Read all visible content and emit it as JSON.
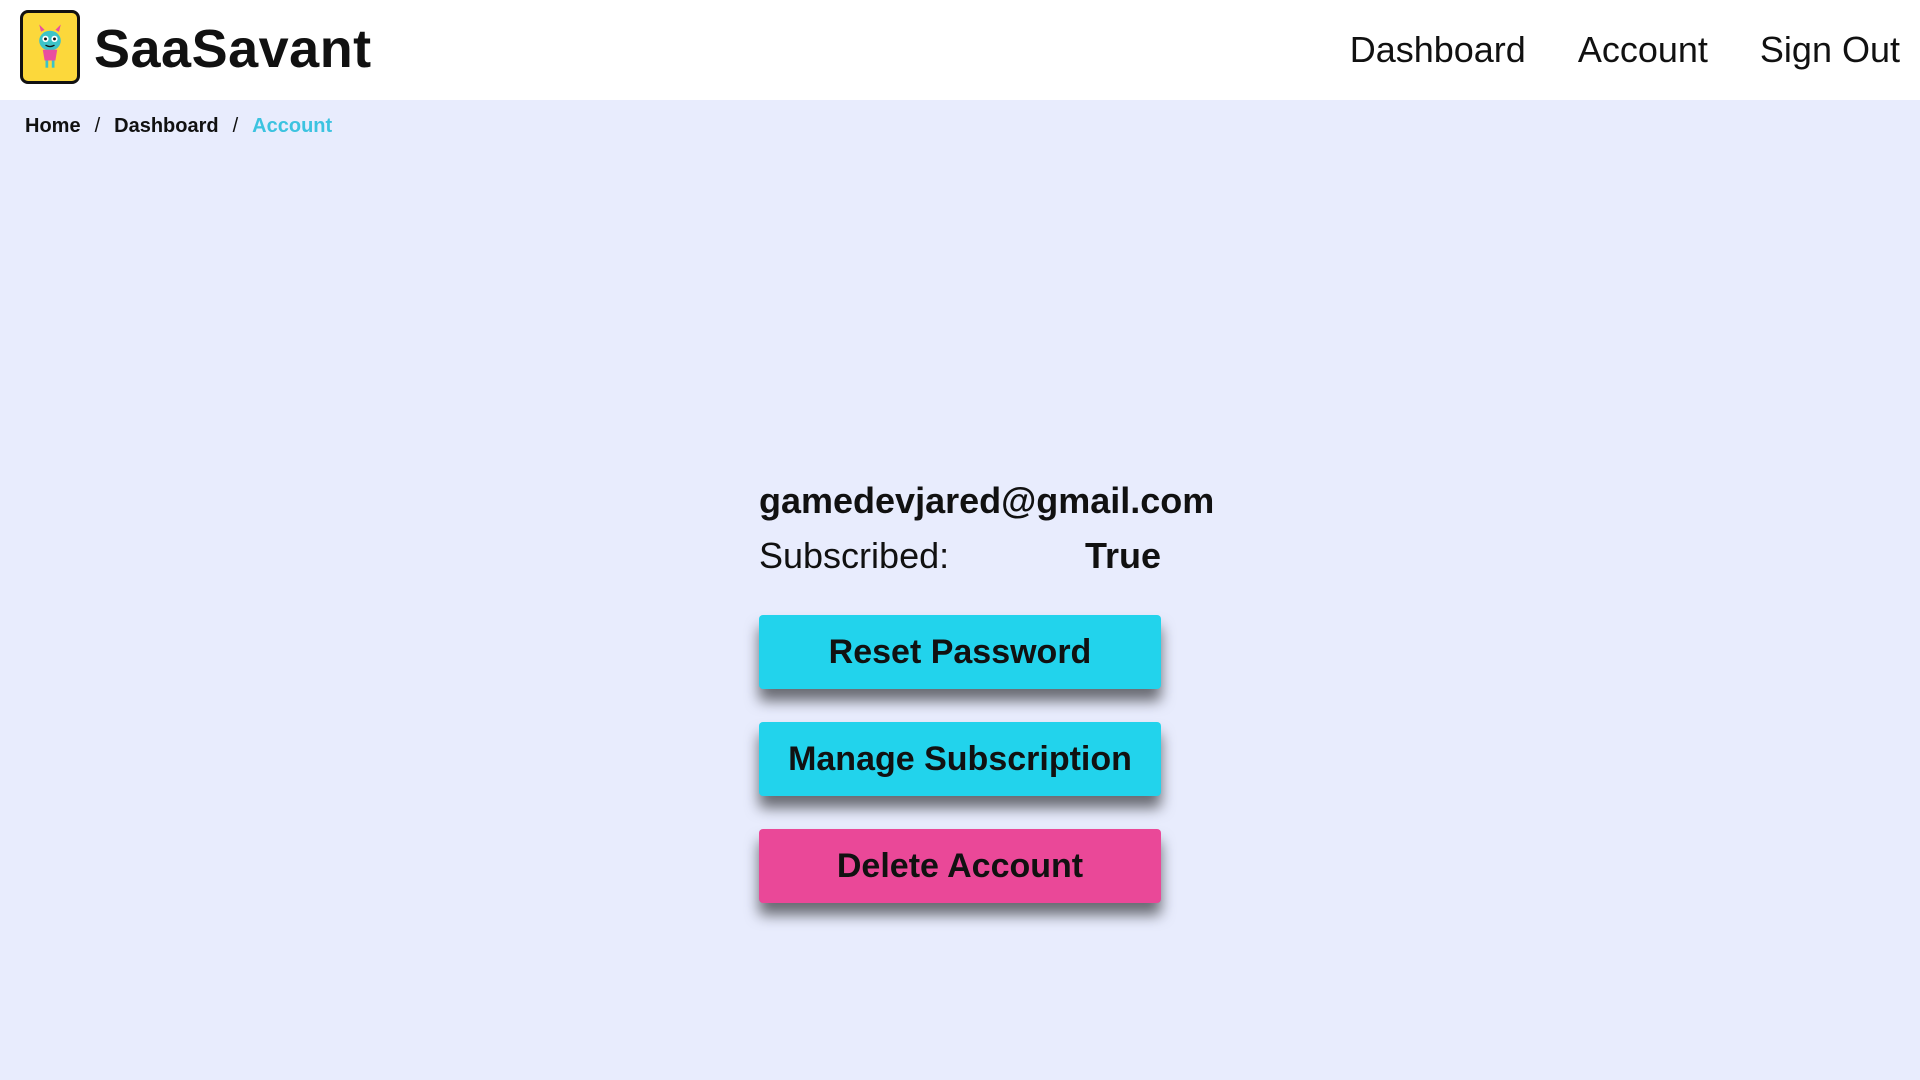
{
  "header": {
    "brand": "SaaSavant",
    "nav": [
      "Dashboard",
      "Account",
      "Sign Out"
    ]
  },
  "breadcrumb": {
    "items": [
      "Home",
      "Dashboard"
    ],
    "separator": "/",
    "current": "Account"
  },
  "account": {
    "email": "gamedevjared@gmail.com",
    "subscribed_label": "Subscribed:",
    "subscribed_value": "True"
  },
  "actions": {
    "reset_password": "Reset Password",
    "manage_subscription": "Manage Subscription",
    "delete_account": "Delete Account"
  },
  "colors": {
    "background": "#e8ecfd",
    "primary": "#22d3ec",
    "danger": "#ea4898",
    "logo_bg": "#fcd83b"
  },
  "icons": {
    "logo": "monster-mascot-icon"
  }
}
